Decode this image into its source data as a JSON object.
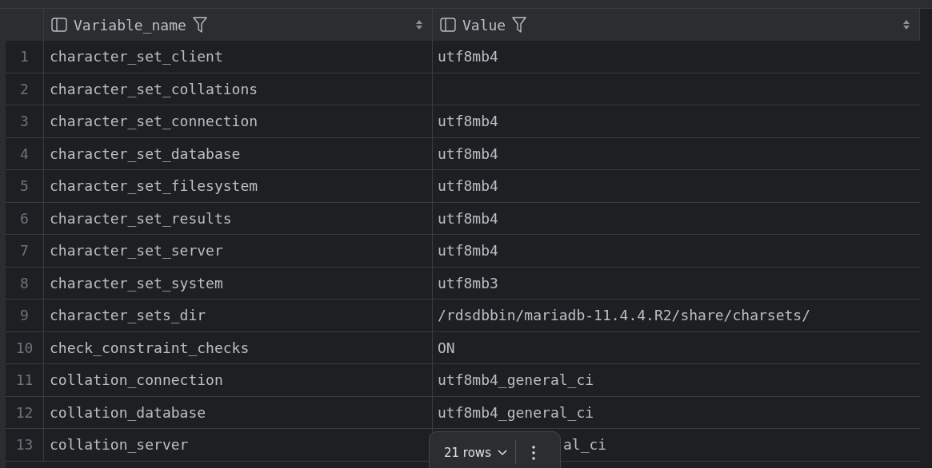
{
  "table": {
    "columns": [
      {
        "label": "Variable_name"
      },
      {
        "label": "Value"
      }
    ],
    "rows": [
      {
        "number": "1",
        "name": "character_set_client",
        "value": "utf8mb4"
      },
      {
        "number": "2",
        "name": "character_set_collations"
      },
      {
        "number": "3",
        "name": "character_set_connection",
        "value": "utf8mb4"
      },
      {
        "number": "4",
        "name": "character_set_database",
        "value": "utf8mb4"
      },
      {
        "number": "5",
        "name": "character_set_filesystem",
        "value": "utf8mb4"
      },
      {
        "number": "6",
        "name": "character_set_results",
        "value": "utf8mb4"
      },
      {
        "number": "7",
        "name": "character_set_server",
        "value": "utf8mb4"
      },
      {
        "number": "8",
        "name": "character_set_system",
        "value": "utf8mb3"
      },
      {
        "number": "9",
        "name": "character_sets_dir",
        "value": "/rdsdbbin/mariadb-11.4.4.R2/share/charsets/"
      },
      {
        "number": "10",
        "name": "check_constraint_checks",
        "value": "ON"
      },
      {
        "number": "11",
        "name": "collation_connection",
        "value": "utf8mb4_general_ci"
      },
      {
        "number": "12",
        "name": "collation_database",
        "value": "utf8mb4_general_ci"
      },
      {
        "number": "13",
        "name": "collation_server",
        "value": "al_ci",
        "covered": true
      }
    ]
  },
  "pager": {
    "rows_label": "21 rows"
  }
}
